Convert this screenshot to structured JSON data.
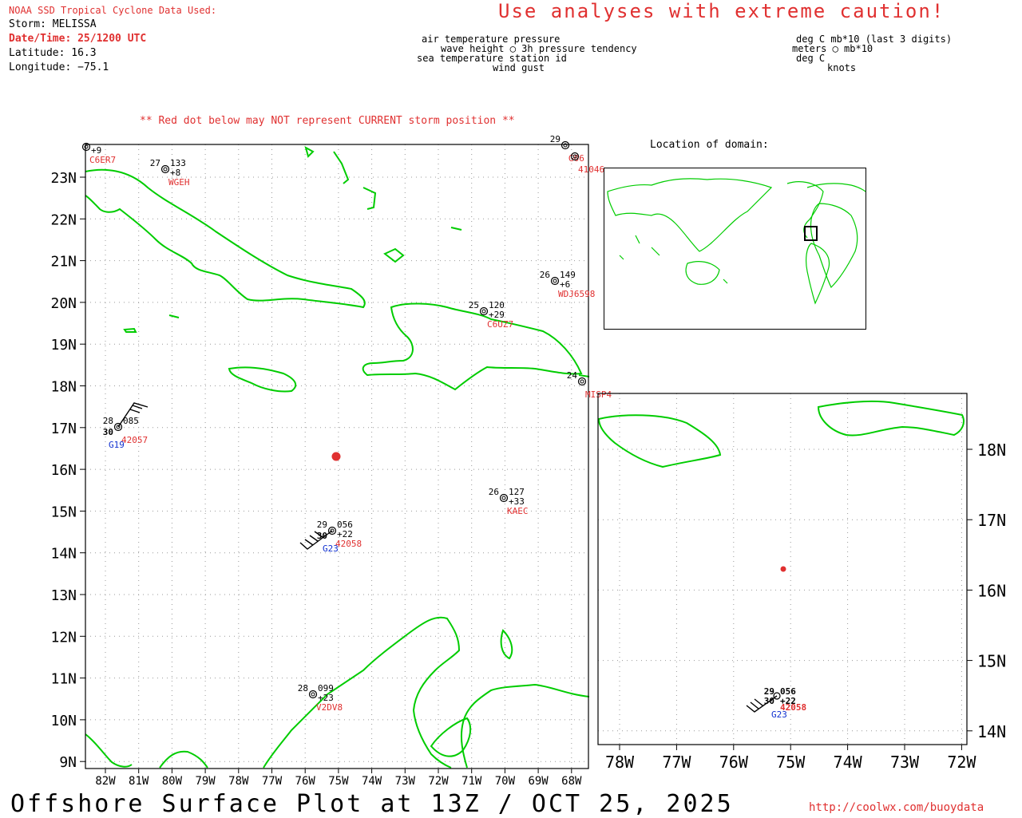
{
  "header": {
    "source": "NOAA SSD Tropical Cyclone Data Used:",
    "storm": "Storm: MELISSA",
    "datetime": "Date/Time: 25/1200 UTC",
    "latitude": "Latitude: 16.3",
    "longitude": "Longitude: −75.1",
    "caution": "Use analyses with extreme caution!"
  },
  "legend": {
    "left": [
      "air temperature   pressure",
      "wave height ◯ 3h pressure tendency",
      "sea temperature    station id",
      "wind gust"
    ],
    "right": [
      "deg C   mb*10 (last 3 digits)",
      "meters ◯ mb*10",
      "deg C",
      "knots"
    ]
  },
  "warning": "** Red dot below may NOT represent CURRENT storm position **",
  "domain_label": "Location of domain:",
  "footer": {
    "title": "Offshore Surface Plot at 13Z / OCT 25, 2025",
    "url": "http://coolwx.com/buoydata"
  },
  "main_map": {
    "lat_labels": [
      "23N",
      "22N",
      "21N",
      "20N",
      "19N",
      "18N",
      "17N",
      "16N",
      "15N",
      "14N",
      "13N",
      "12N",
      "11N",
      "10N",
      "9N"
    ],
    "lon_labels": [
      "82W",
      "81W",
      "80W",
      "79W",
      "78W",
      "77W",
      "76W",
      "75W",
      "74W",
      "73W",
      "72W",
      "71W",
      "70W",
      "69W",
      "68W"
    ],
    "storm": {
      "lat": 16.3,
      "lon": -75.1
    },
    "stations": [
      {
        "id": "C6ER7",
        "temp": "",
        "press": "",
        "tend": "+9",
        "gust": ""
      },
      {
        "id": "WGEH",
        "temp": "27",
        "press": "133",
        "tend": "+8",
        "gust": ""
      },
      {
        "id": "G06",
        "temp": "29",
        "press": "",
        "tend": "",
        "gust": ""
      },
      {
        "id": "41046",
        "temp": "",
        "press": "",
        "tend": "",
        "gust": ""
      },
      {
        "id": "WDJ6598",
        "temp": "26",
        "press": "149",
        "tend": "+6",
        "gust": ""
      },
      {
        "id": "C6UZ7",
        "temp": "25",
        "press": "120",
        "tend": "+29",
        "gust": ""
      },
      {
        "id": "MISP4",
        "temp": "24",
        "press": "",
        "tend": "",
        "gust": ""
      },
      {
        "id": "42057",
        "temp": "28",
        "press": "085",
        "tend": "",
        "wave": "30",
        "gust": "G19"
      },
      {
        "id": "KAEC",
        "temp": "26",
        "press": "127",
        "tend": "+33",
        "gust": ""
      },
      {
        "id": "42058",
        "temp": "29",
        "press": "056",
        "tend": "+22",
        "wave": "30",
        "gust": "G23"
      },
      {
        "id": "V2DV8",
        "temp": "28",
        "press": "099",
        "tend": "+23",
        "gust": ""
      }
    ]
  },
  "inset_map": {
    "lat_labels": [
      "18N",
      "17N",
      "16N",
      "15N",
      "14N"
    ],
    "lon_labels": [
      "78W",
      "77W",
      "76W",
      "75W",
      "74W",
      "73W",
      "72W"
    ],
    "station": {
      "id": "42058",
      "temp": "29",
      "press": "056",
      "tend": "+22",
      "wave": "30",
      "gust": "G23"
    }
  },
  "colors": {
    "coast": "#00cc00",
    "red": "#e03030",
    "blue": "#1030d0",
    "grid": "#999999"
  }
}
